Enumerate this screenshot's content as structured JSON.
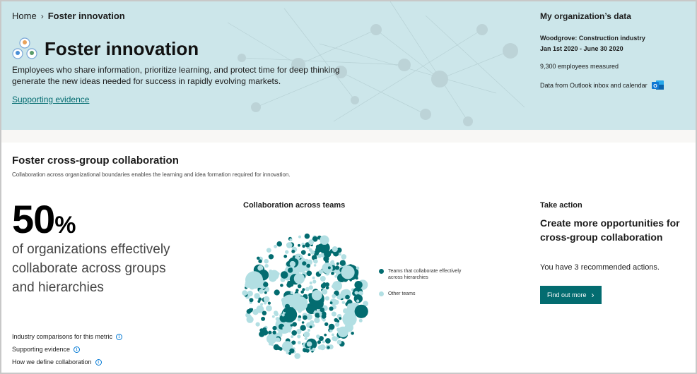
{
  "breadcrumb": {
    "home": "Home",
    "current": "Foster innovation"
  },
  "hero": {
    "title": "Foster innovation",
    "icon": "team-people-icon",
    "description": "Employees who share information, prioritize learning, and protect time for deep thinking generate the new ideas needed for success in rapidly evolving markets.",
    "link": "Supporting evidence",
    "bg_color": "#cce6ea"
  },
  "org": {
    "heading": "My organization’s data",
    "company": "Woodgrove:  Construction industry",
    "date_range": "Jan 1st 2020 - June 30 2020",
    "employees": "9,300 employees measured",
    "source": "Data from Outlook inbox and calendar",
    "source_icon": "outlook-icon"
  },
  "section": {
    "title": "Foster cross-group collaboration",
    "subtitle": "Collaboration across organizational boundaries enables the learning and idea formation required for innovation."
  },
  "metric": {
    "value": "50",
    "unit": "%",
    "description": "of organizations effectively collaborate across groups and hierarchies",
    "links": [
      "Industry comparisons for this metric",
      "Supporting evidence",
      "How we define collaboration"
    ]
  },
  "chart": {
    "title": "Collaboration across teams",
    "legend": [
      {
        "label": "Teams that collaborate effectively across hierarchies",
        "color": "#036c70"
      },
      {
        "label": "Other teams",
        "color": "#b2dfe3"
      }
    ]
  },
  "action": {
    "label": "Take action",
    "title": "Create more opportunities for cross-group collaboration",
    "count_text": "You have 3 recommended actions.",
    "button": "Find out more"
  },
  "colors": {
    "accent": "#036c70",
    "light": "#b2dfe3",
    "link": "#0078d4"
  }
}
